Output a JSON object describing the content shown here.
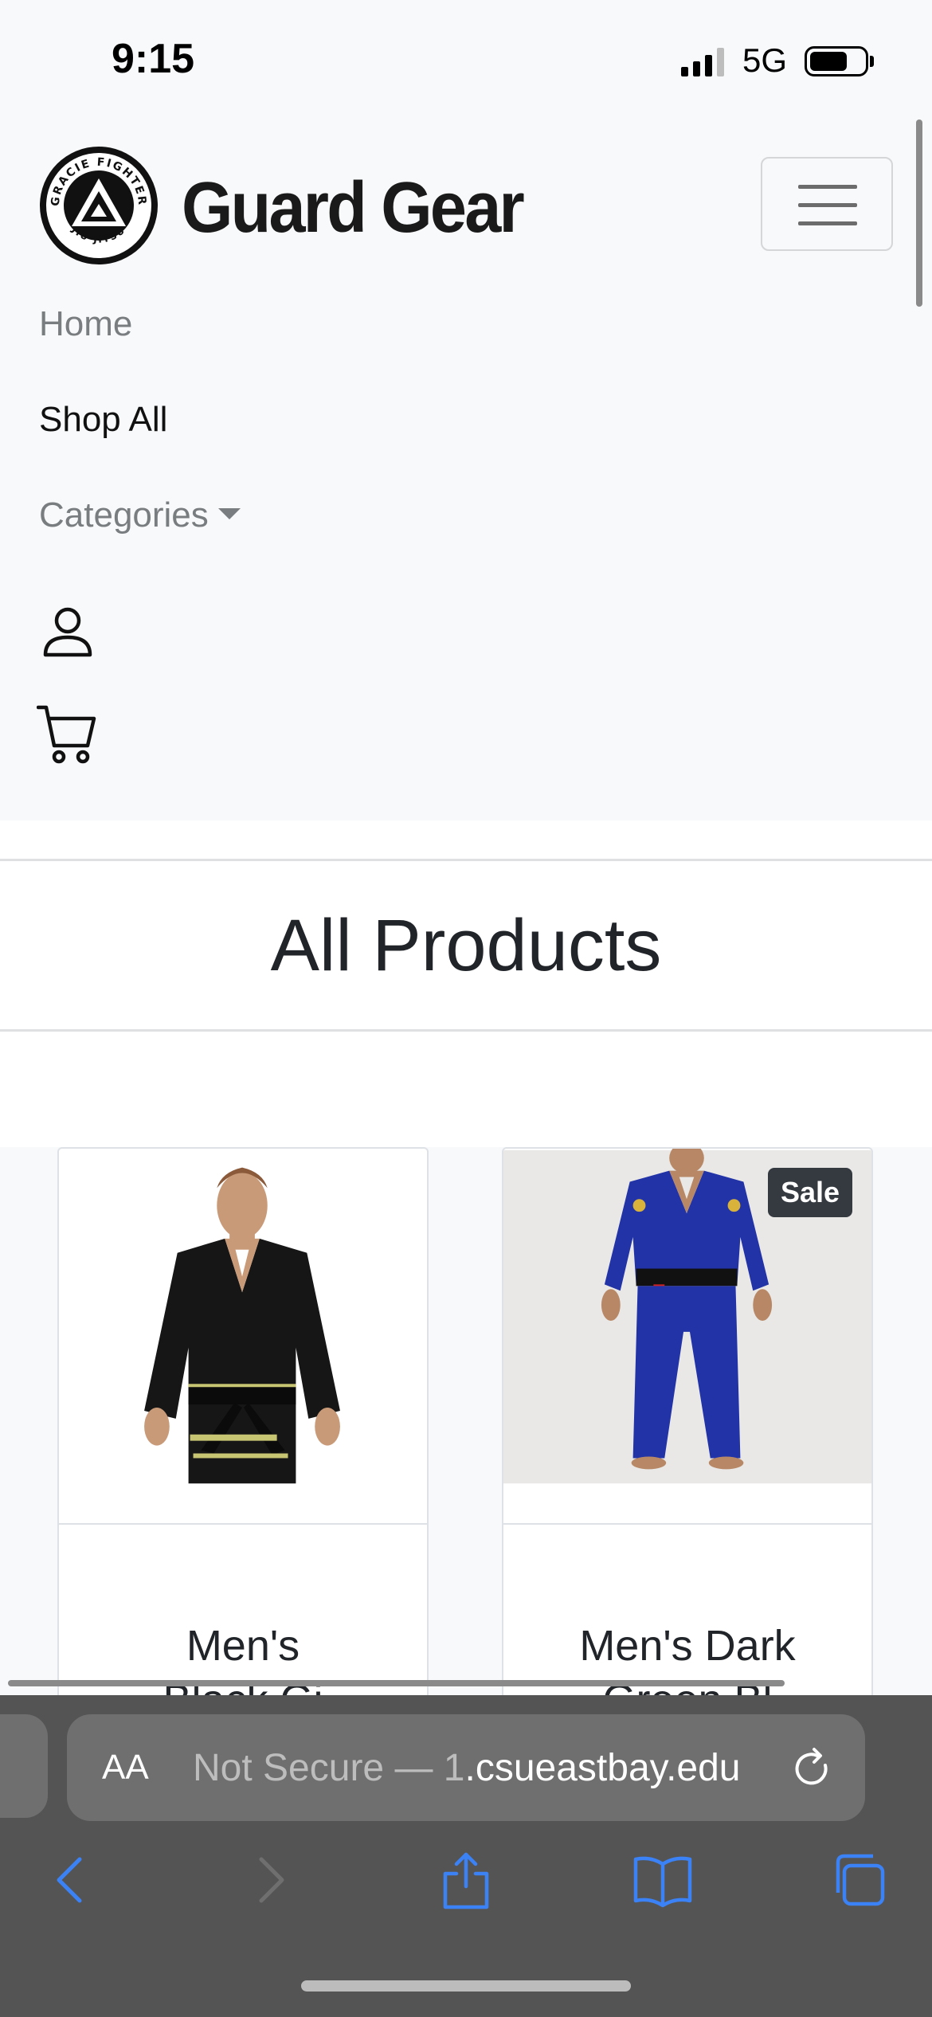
{
  "status_bar": {
    "time": "9:15",
    "network": "5G"
  },
  "navbar": {
    "brand": "Guard Gear",
    "logo": {
      "text_top": "GRACIE FIGHTER",
      "text_bottom": "JIU-JITSU"
    },
    "links": [
      {
        "label": "Home"
      },
      {
        "label": "Shop All"
      },
      {
        "label": "Categories"
      }
    ],
    "icons": [
      "user-icon",
      "cart-icon"
    ]
  },
  "main": {
    "title": "All Products",
    "products": [
      {
        "title": "Men's\nBlack Gi",
        "badge": "",
        "image": "black-gi-photo"
      },
      {
        "title": "Men's Dark\nGreen Bl",
        "badge": "Sale",
        "image": "blue-gi-photo"
      }
    ]
  },
  "browser": {
    "aa_label": "AA",
    "url_prefix": "Not Secure — 1",
    "url_domain": ".csueastbay.edu"
  },
  "colors": {
    "safari_bar": "#545454",
    "link_blue": "#3b82f6",
    "badge": "#343a40"
  }
}
